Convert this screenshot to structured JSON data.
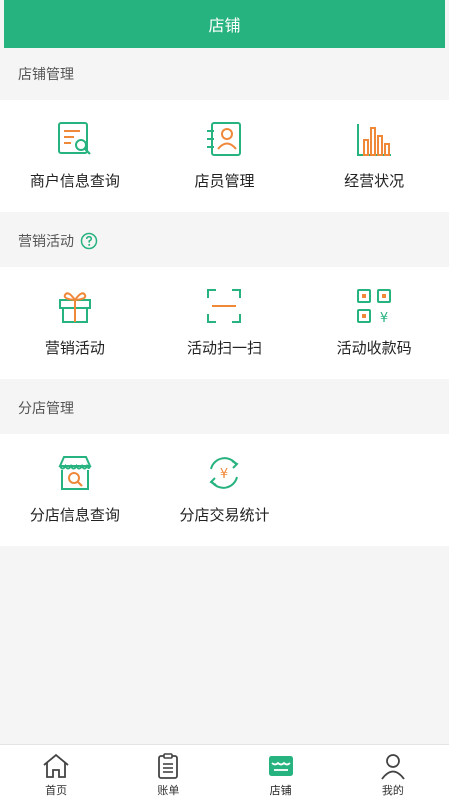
{
  "header": {
    "title": "店铺"
  },
  "colors": {
    "brand": "#27b37f",
    "accent": "#f0883a"
  },
  "sections": [
    {
      "title": "店铺管理",
      "items": [
        {
          "label": "商户信息查询",
          "icon": "merchant-search-icon"
        },
        {
          "label": "店员管理",
          "icon": "staff-card-icon"
        },
        {
          "label": "经营状况",
          "icon": "bar-chart-icon"
        }
      ]
    },
    {
      "title": "营销活动",
      "help_icon": "help-circle-icon",
      "items": [
        {
          "label": "营销活动",
          "icon": "gift-icon"
        },
        {
          "label": "活动扫一扫",
          "icon": "scan-icon"
        },
        {
          "label": "活动收款码",
          "icon": "qr-payment-icon"
        }
      ]
    },
    {
      "title": "分店管理",
      "items": [
        {
          "label": "分店信息查询",
          "icon": "store-search-icon"
        },
        {
          "label": "分店交易统计",
          "icon": "exchange-stats-icon"
        }
      ]
    }
  ],
  "tabbar": {
    "items": [
      {
        "label": "首页",
        "icon": "home-icon",
        "active": false
      },
      {
        "label": "账单",
        "icon": "clipboard-icon",
        "active": false
      },
      {
        "label": "店铺",
        "icon": "store-icon",
        "active": true
      },
      {
        "label": "我的",
        "icon": "user-icon",
        "active": false
      }
    ]
  }
}
